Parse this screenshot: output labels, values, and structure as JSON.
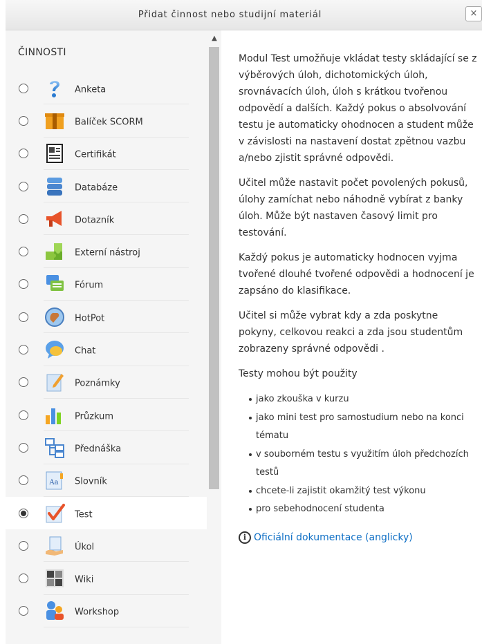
{
  "dialog": {
    "title": "Přidat činnost nebo studijní materiál",
    "close_label": "×"
  },
  "activities": {
    "section_title": "ČINNOSTI",
    "selected": "Test",
    "items": [
      {
        "label": "Anketa",
        "icon": "question-icon"
      },
      {
        "label": "Balíček SCORM",
        "icon": "package-icon"
      },
      {
        "label": "Certifikát",
        "icon": "certificate-icon"
      },
      {
        "label": "Databáze",
        "icon": "database-icon"
      },
      {
        "label": "Dotazník",
        "icon": "megaphone-icon"
      },
      {
        "label": "Externí nástroj",
        "icon": "puzzle-icon"
      },
      {
        "label": "Fórum",
        "icon": "forum-icon"
      },
      {
        "label": "HotPot",
        "icon": "hotpot-icon"
      },
      {
        "label": "Chat",
        "icon": "chat-icon"
      },
      {
        "label": "Poznámky",
        "icon": "notes-icon"
      },
      {
        "label": "Průzkum",
        "icon": "survey-chart-icon"
      },
      {
        "label": "Přednáška",
        "icon": "lesson-icon"
      },
      {
        "label": "Slovník",
        "icon": "glossary-icon"
      },
      {
        "label": "Test",
        "icon": "quiz-check-icon"
      },
      {
        "label": "Úkol",
        "icon": "assignment-icon"
      },
      {
        "label": "Wiki",
        "icon": "wiki-icon"
      },
      {
        "label": "Workshop",
        "icon": "workshop-icon"
      }
    ]
  },
  "description": {
    "paragraphs": [
      "Modul Test umožňuje vkládat testy skládající se z výběrových úloh, dichotomických úloh, srovnávacích úloh, úloh s krátkou tvořenou odpovědí a dalších. Každý pokus o absolvování testu je automaticky ohodnocen a student může v závislosti na nastavení dostat zpětnou vazbu a/nebo zjistit správné odpovědi.",
      "Učitel může nastavit počet povolených pokusů, úlohy zamíchat nebo náhodně vybírat z banky úloh. Může být nastaven časový limit pro testování.",
      "Každý pokus je automaticky hodnocen vyjma tvořené dlouhé tvořené odpovědi a hodnocení je zapsáno do klasifikace.",
      "Učitel si může vybrat kdy a zda poskytne pokyny, celkovou reakci a zda jsou studentům zobrazeny správné odpovědi .",
      "Testy mohou být použity"
    ],
    "uses": [
      "jako zkouška v kurzu",
      "jako mini test pro samostudium nebo na konci tématu",
      "v souborném testu s využitím úloh předchozích testů",
      "chcete-li zajistit okamžitý test výkonu",
      "pro sebehodnocení studenta"
    ],
    "doc_link": "Oficiální dokumentace (anglicky)"
  },
  "colors": {
    "link": "#0f6fc5",
    "panel_bg": "#f5f5f5",
    "scroll_thumb": "#c1c1c1"
  }
}
